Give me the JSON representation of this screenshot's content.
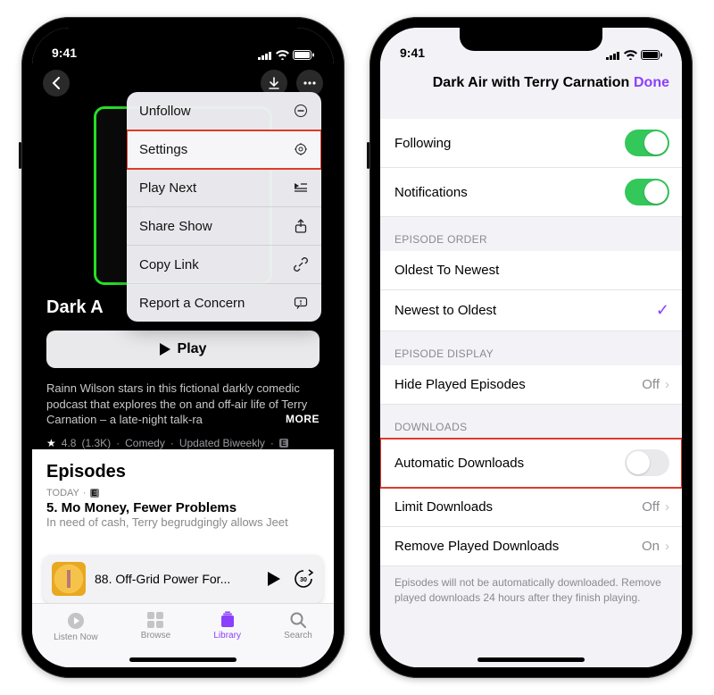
{
  "status": {
    "time": "9:41"
  },
  "left": {
    "show_title_truncated": "Dark A",
    "play_label": "Play",
    "description": "Rainn Wilson stars in this fictional darkly comedic podcast that explores the on and off-air life of Terry Carnation – a late-night talk-ra",
    "more_label": "MORE",
    "rating_star": "★",
    "rating_value": "4.8",
    "rating_count": "(1.3K)",
    "category": "Comedy",
    "schedule": "Updated Biweekly",
    "episodes_header": "Episodes",
    "today_label": "TODAY",
    "episode_title": "5. Mo Money, Fewer Problems",
    "episode_desc": "In need of cash, Terry begrudgingly allows Jeet",
    "now_playing_title": "88. Off-Grid Power For...",
    "menu": {
      "unfollow": "Unfollow",
      "settings": "Settings",
      "play_next": "Play Next",
      "share_show": "Share Show",
      "copy_link": "Copy Link",
      "report": "Report a Concern"
    },
    "tabs": {
      "listen_now": "Listen Now",
      "browse": "Browse",
      "library": "Library",
      "search": "Search"
    }
  },
  "right": {
    "nav_title": "Dark Air with Terry Carnation",
    "done": "Done",
    "following": "Following",
    "notifications": "Notifications",
    "group_order": "EPISODE ORDER",
    "oldest": "Oldest To Newest",
    "newest": "Newest to Oldest",
    "group_display": "EPISODE DISPLAY",
    "hide_played": "Hide Played Episodes",
    "group_downloads": "DOWNLOADS",
    "auto_dl": "Automatic Downloads",
    "limit_dl": "Limit Downloads",
    "remove_played": "Remove Played Downloads",
    "val_off": "Off",
    "val_on": "On",
    "footer": "Episodes will not be automatically downloaded. Remove played downloads 24 hours after they finish playing."
  }
}
